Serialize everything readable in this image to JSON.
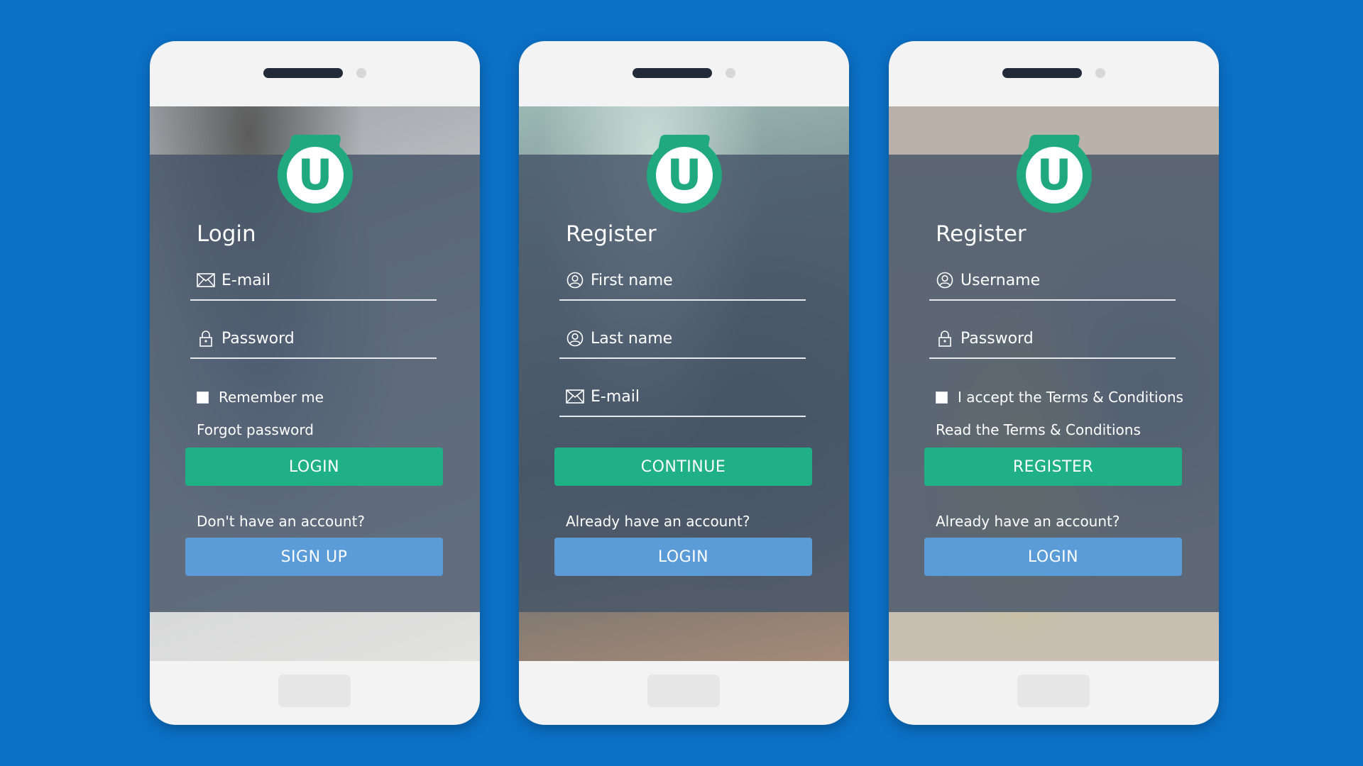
{
  "colors": {
    "background": "#0b70c6",
    "primary_button": "#1fb085",
    "secondary_button": "#5b9bd8",
    "logo": "#20a97e",
    "overlay": "#465468"
  },
  "logo_letter": "U",
  "screens": [
    {
      "title": "Login",
      "fields": [
        {
          "label": "E-mail",
          "icon": "envelope-icon"
        },
        {
          "label": "Password",
          "icon": "lock-icon"
        }
      ],
      "checkbox_label": "Remember me",
      "link": "Forgot password",
      "primary_button": "LOGIN",
      "prompt": "Don't have an account?",
      "secondary_button": "SIGN UP"
    },
    {
      "title": "Register",
      "fields": [
        {
          "label": "First name",
          "icon": "user-icon"
        },
        {
          "label": "Last name",
          "icon": "user-icon"
        },
        {
          "label": "E-mail",
          "icon": "envelope-icon"
        }
      ],
      "primary_button": "CONTINUE",
      "prompt": "Already have an account?",
      "secondary_button": "LOGIN"
    },
    {
      "title": "Register",
      "fields": [
        {
          "label": "Username",
          "icon": "user-icon"
        },
        {
          "label": "Password",
          "icon": "lock-icon"
        }
      ],
      "checkbox_label": "I accept the Terms & Conditions",
      "link": "Read the Terms & Conditions",
      "primary_button": "REGISTER",
      "prompt": "Already have an account?",
      "secondary_button": "LOGIN"
    }
  ]
}
